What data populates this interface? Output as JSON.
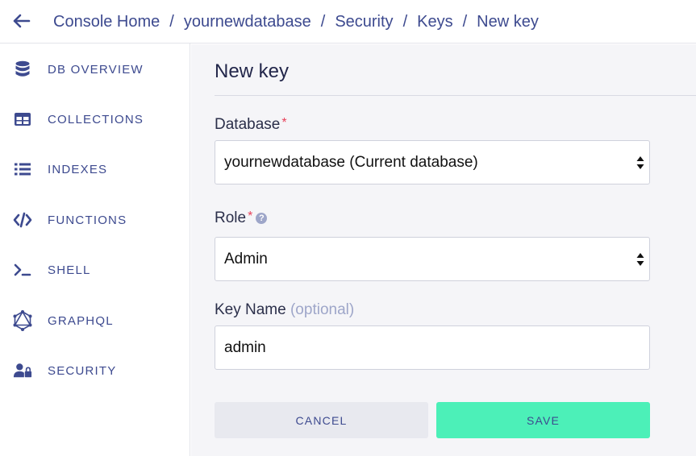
{
  "breadcrumb": {
    "items": [
      "Console Home",
      "yournewdatabase",
      "Security",
      "Keys",
      "New key"
    ],
    "separator": "/"
  },
  "sidebar": {
    "items": [
      {
        "label": "DB OVERVIEW",
        "icon": "database-icon"
      },
      {
        "label": "COLLECTIONS",
        "icon": "table-icon"
      },
      {
        "label": "INDEXES",
        "icon": "list-icon"
      },
      {
        "label": "FUNCTIONS",
        "icon": "code-icon"
      },
      {
        "label": "SHELL",
        "icon": "terminal-icon"
      },
      {
        "label": "GRAPHQL",
        "icon": "graphql-icon"
      },
      {
        "label": "SECURITY",
        "icon": "users-lock-icon"
      }
    ]
  },
  "main": {
    "title": "New key",
    "database": {
      "label": "Database",
      "required_mark": "*",
      "value": "yournewdatabase (Current database)"
    },
    "role": {
      "label": "Role",
      "required_mark": "*",
      "help": "?",
      "value": "Admin"
    },
    "key_name": {
      "label": "Key Name",
      "optional": "(optional)",
      "value": "admin"
    },
    "buttons": {
      "cancel": "CANCEL",
      "save": "SAVE"
    }
  },
  "colors": {
    "accent": "#3d4a8f",
    "save": "#4cf0b8",
    "required": "#e8425b",
    "background": "#f5f5f8"
  }
}
